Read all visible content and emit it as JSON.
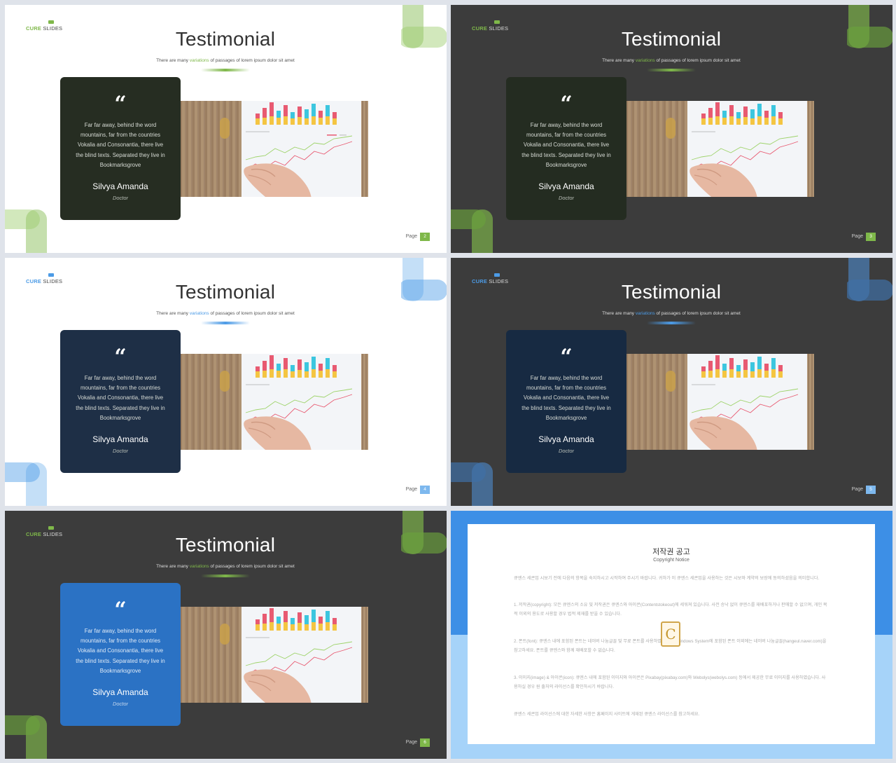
{
  "common": {
    "logo_cure": "CURE",
    "logo_slides": " SLIDES",
    "title": "Testimonial",
    "subtitle_pre": "There are many ",
    "subtitle_highlight": "variations",
    "subtitle_post": " of passages of lorem ipsum dolor sit amet",
    "quote_mark": "“",
    "quote_text": "Far far away, behind the word mountains, far from the countries Vokalia and Consonantia, there live the blind texts. Separated they live in Bookmarksgrove",
    "person_name": "Silvya Amanda",
    "person_role": "Doctor",
    "page_label": "Page"
  },
  "slides": [
    {
      "theme": "light",
      "accent": "#7fb84a",
      "card_color": "#262d22",
      "page_number": "2"
    },
    {
      "theme": "dark",
      "accent": "#7fb84a",
      "card_color": "#242c21",
      "page_number": "3"
    },
    {
      "theme": "light",
      "accent": "#4c9be6",
      "card_color": "#1e2f46",
      "page_number": "4"
    },
    {
      "theme": "dark",
      "accent": "#4c9be6",
      "card_color": "#172a42",
      "page_number": "5"
    },
    {
      "theme": "dark",
      "accent": "#7fb84a",
      "card_color": "#2b72c4",
      "page_number": "6"
    }
  ],
  "copyright": {
    "title": "저작권 공고",
    "subtitle": "Copyright Notice",
    "paragraphs": [
      "큐엔스 세콘업 시보기 전에 다음의 항목을 숙지하시고 시작하여 주시기 바랍니다. 귀하가 이 큐엔스 세콘업을 사용하는 것은 시보와 계약의 보장에 동의하셨음을 의미합니다.",
      "1. 저작권(copyright): 모든 큐엔스의 소유 및 저작권은 큐엔스와 아이콘(Contentstokeout)에 세워져 있습니다. 사전 승낙 없이 큐엔스를 재배포하거나 판매할 수 없으며, 개인 목적 이외의 용도로 사용할 경우 법적 제재를 받을 수 있습니다.",
      "2. 폰트(font): 큐엔스 내에 포함된 폰트는 네이버 나눔글꼴 및 무료 폰트를 사용하였습니다. Windows System에 포함된 폰트 이외에는 네이버 나눔글꼴(hangeul.naver.com)을 참고하세요. 폰트를 큐엔스와 함께 재배포할 수 없습니다.",
      "3. 이미지(image) & 아이콘(icon): 큐엔스 내에 포함된 이미지와 아이콘은 Pixabay(pixabay.com)와 Webolys(webolys.com) 등에서 제공한 무료 이미지를 사용하였습니다. 사용하실 경우 원 출처의 라이선스를 확인하시기 바랍니다.",
      "큐엔스 세콘업 라이선스에 대한 자세한 사항은 홈페이지 사이트에 게재된 큐엔스 라이선스를 참고하세요."
    ]
  }
}
